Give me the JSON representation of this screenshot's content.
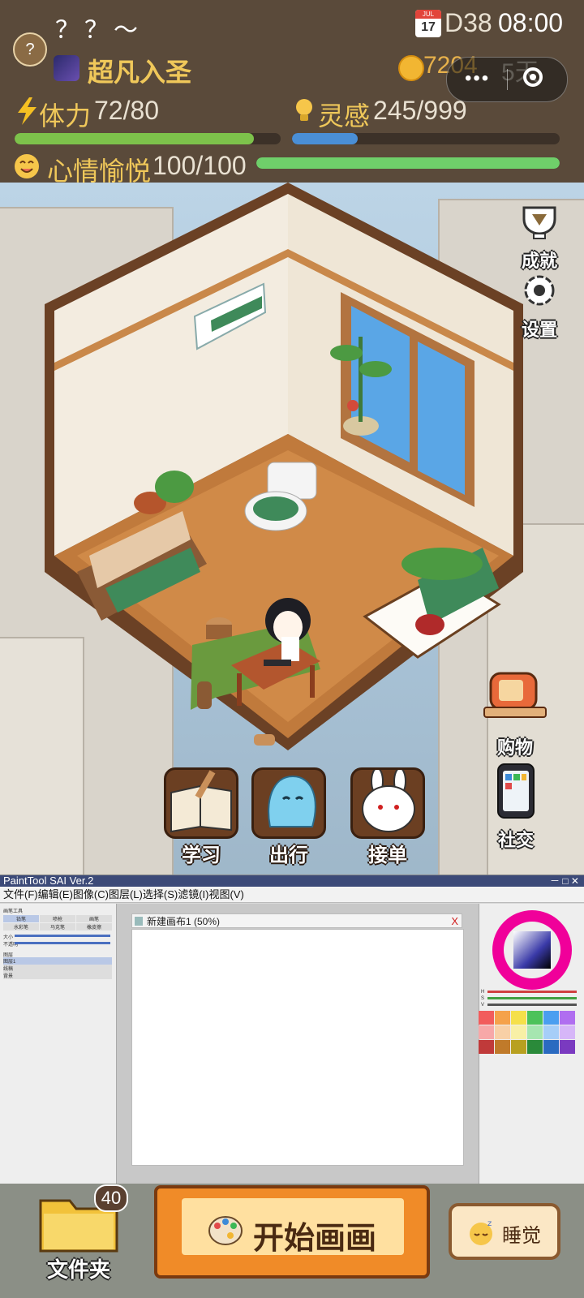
{
  "hud": {
    "avatar_glyph": "?",
    "nickname": "？？～",
    "rank": "超凡入圣",
    "calendar_month": "JUL",
    "calendar_day": "17",
    "day": "D38",
    "time": "08:00",
    "coins": "7204",
    "days_left": "5天",
    "stamina_label": "体力",
    "stamina_value": "72/80",
    "stamina_level": 0.9,
    "inspiration_label": "灵感",
    "inspiration_value": "245/999",
    "inspiration_level": 0.245,
    "mood_label": "心情愉悦",
    "mood_value": "100/100",
    "mood_level": 1.0,
    "colors": {
      "stamina": "#7dc24b",
      "inspiration": "#4a8fd6",
      "mood": "#6fcf6a",
      "accent": "#f0c85a"
    }
  },
  "capsule": {
    "more_glyph": "•••"
  },
  "side_buttons": {
    "achievements": "成就",
    "settings": "设置",
    "shop": "购物",
    "social": "社交"
  },
  "actions": {
    "study": "学习",
    "travel": "出行",
    "orders": "接单"
  },
  "sai": {
    "title": "PaintTool SAI Ver.2",
    "menu": "文件(F)编辑(E)图像(C)图层(L)选择(S)滤镜(I)视图(V)",
    "canvas_title": "新建画布1 (50%)",
    "close_glyph": "X",
    "tool_group": "画笔工具",
    "tools": [
      "铅笔",
      "喷枪",
      "画笔",
      "水彩笔",
      "马克笔",
      "橡皮擦"
    ],
    "size_label": "大小",
    "opacity_label": "不透明",
    "layer_group": "图层",
    "layers": [
      "图层1",
      "线稿",
      "背景"
    ],
    "hsv": [
      "H",
      "S",
      "V"
    ]
  },
  "bottom": {
    "folder_label": "文件夹",
    "folder_count": "40",
    "start_label": "开始画画",
    "sleep_label": "睡觉"
  }
}
